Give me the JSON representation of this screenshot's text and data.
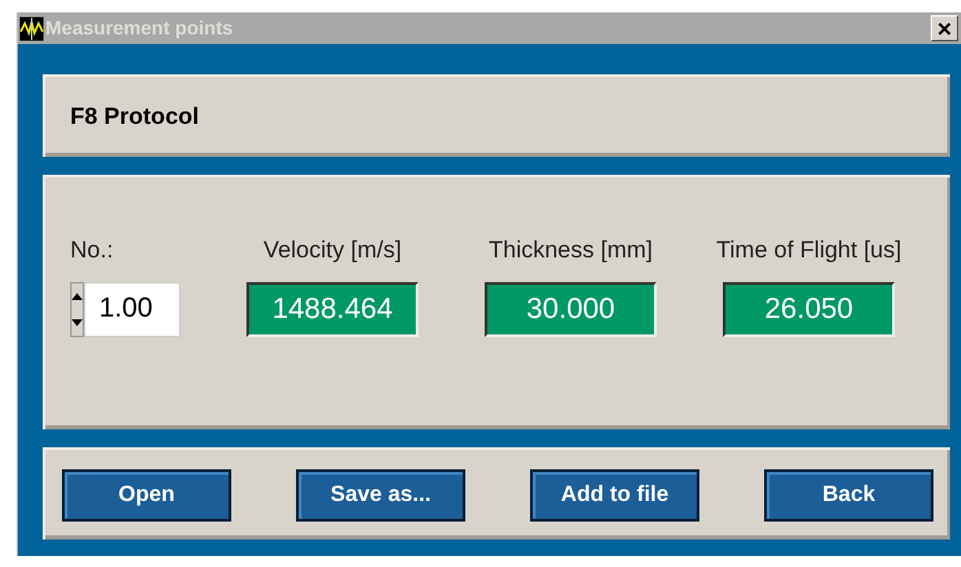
{
  "window": {
    "title": "Measurement points",
    "close": "×"
  },
  "header": {
    "title": "F8 Protocol"
  },
  "number": {
    "label": "No.:",
    "value": "1.00"
  },
  "readings": [
    {
      "label": "Velocity [m/s]",
      "value": "1488.464"
    },
    {
      "label": "Thickness [mm]",
      "value": "30.000"
    },
    {
      "label": "Time of Flight [us]",
      "value": "26.050"
    }
  ],
  "buttons": [
    "Open",
    "Save as...",
    "Add to file",
    "Back"
  ]
}
